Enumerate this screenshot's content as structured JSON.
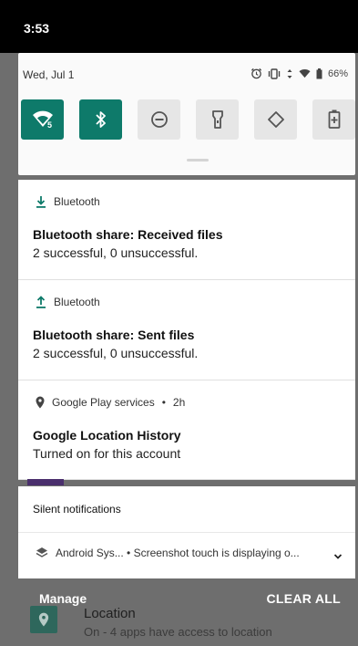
{
  "status_bar": {
    "time": "3:53"
  },
  "quick_settings": {
    "date": "Wed, Jul 1",
    "battery": "66%",
    "wifi_badge": "5",
    "tiles": [
      {
        "name": "wifi",
        "active": true
      },
      {
        "name": "bluetooth",
        "active": true
      },
      {
        "name": "do-not-disturb",
        "active": false
      },
      {
        "name": "flashlight",
        "active": false
      },
      {
        "name": "auto-rotate",
        "active": false
      },
      {
        "name": "battery-saver",
        "active": false
      }
    ]
  },
  "notifications": [
    {
      "app": "Bluetooth",
      "title": "Bluetooth share: Received files",
      "text": "2 successful, 0 unsuccessful."
    },
    {
      "app": "Bluetooth",
      "title": "Bluetooth share: Sent files",
      "text": "2 successful, 0 unsuccessful."
    },
    {
      "app": "Google Play services",
      "time": "2h",
      "title": "Google Location History",
      "text": "Turned on for this account"
    }
  ],
  "silent": {
    "header": "Silent notifications",
    "row": "Android Sys... • Screenshot touch is displaying o..."
  },
  "footer": {
    "manage": "Manage",
    "clear_all": "CLEAR ALL",
    "location_title": "Location",
    "location_sub": "On - 4 apps have access to location"
  },
  "colors": {
    "accent": "#0e7a6a"
  }
}
